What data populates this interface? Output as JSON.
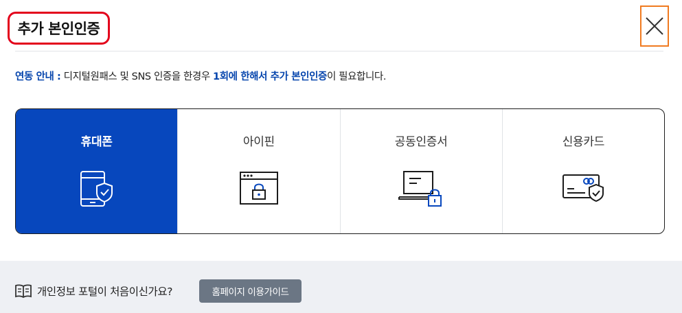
{
  "dialog": {
    "title": "추가 본인인증",
    "close_icon": "close-icon"
  },
  "notice": {
    "prefix": "연동 안내 :",
    "text1": " 디지털원패스 및 SNS 인증을 한경우 ",
    "highlight": "1회에 한해서 추가 본인인증",
    "text2": "이 필요합니다."
  },
  "methods": [
    {
      "label": "휴대폰",
      "icon": "phone-shield-icon",
      "active": true
    },
    {
      "label": "아이핀",
      "icon": "window-lock-icon",
      "active": false
    },
    {
      "label": "공동인증서",
      "icon": "laptop-lock-icon",
      "active": false
    },
    {
      "label": "신용카드",
      "icon": "card-shield-icon",
      "active": false
    }
  ],
  "footer": {
    "book_icon": "book-icon",
    "question": "개인정보 포털이 처음이신가요?",
    "guide_button": "홈페이지 이용가이드"
  },
  "colors": {
    "accent": "#0747bd",
    "title_border": "#e3001b",
    "close_border": "#f07a1f",
    "footer_bg": "#eef0f4",
    "guide_button_bg": "#6b7684"
  }
}
